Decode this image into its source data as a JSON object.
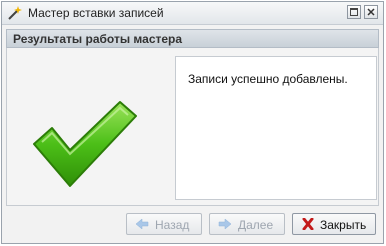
{
  "window": {
    "title": "Мастер вставки записей",
    "icon": "wand-icon"
  },
  "header": {
    "title": "Результаты работы мастера"
  },
  "content": {
    "status_icon": "checkmark-icon",
    "message": "Записи успешно добавлены."
  },
  "buttons": {
    "back": {
      "label": "Назад",
      "icon": "arrow-left-icon",
      "enabled": false
    },
    "next": {
      "label": "Далее",
      "icon": "arrow-right-icon",
      "enabled": false
    },
    "close": {
      "label": "Закрыть",
      "icon": "close-icon",
      "enabled": true
    }
  },
  "colors": {
    "check_green": "#3fae0e",
    "disabled_arrow": "#a9c7e8",
    "close_red": "#c31a1a"
  }
}
